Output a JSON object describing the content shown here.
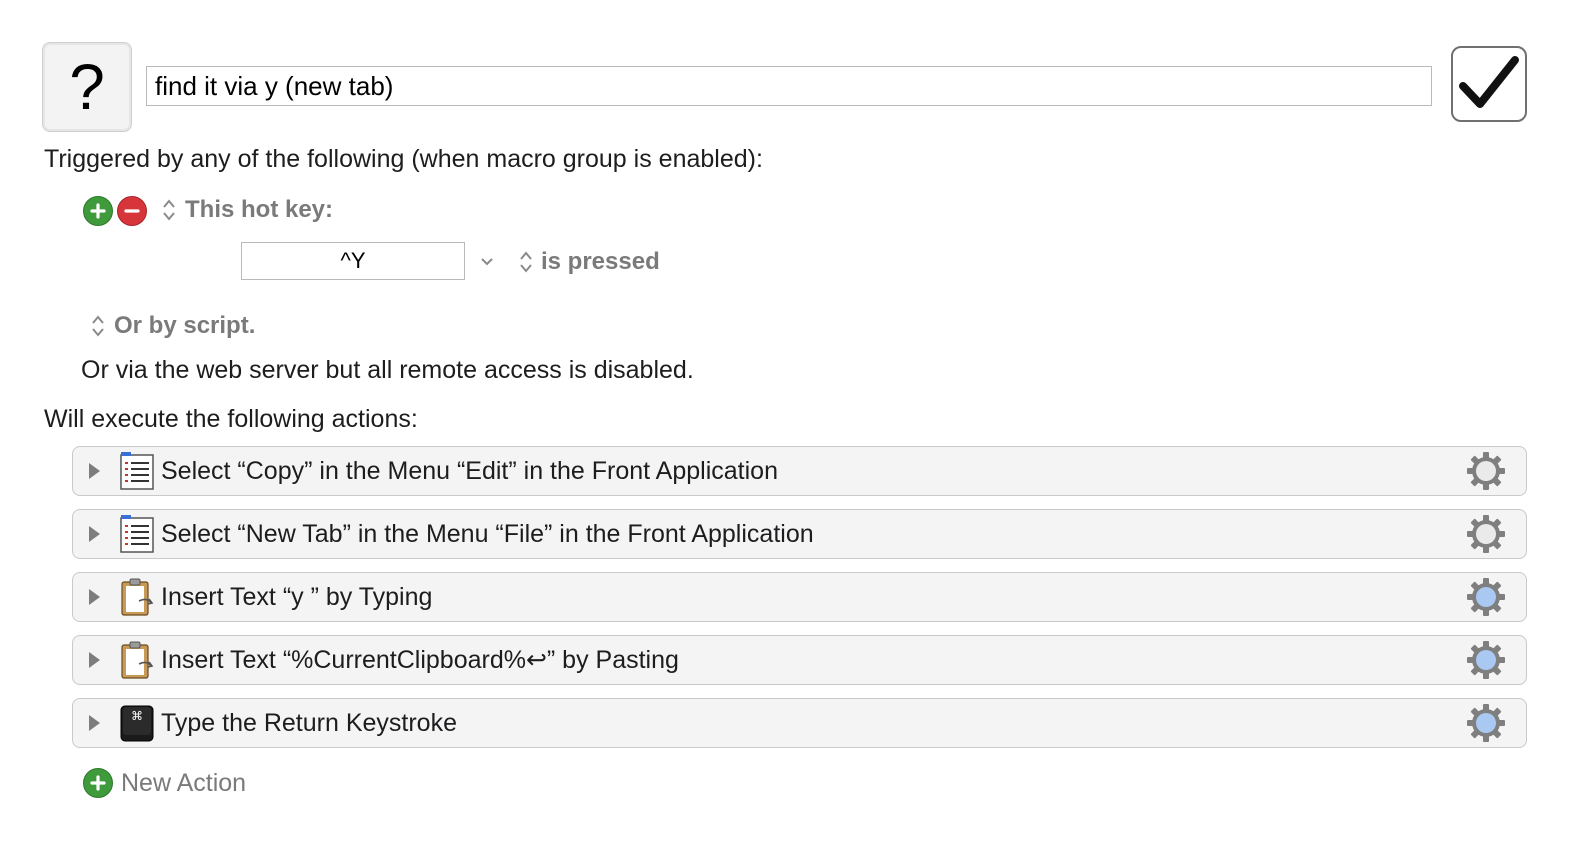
{
  "macro": {
    "icon_glyph": "?",
    "name": "find it via y (new tab)",
    "enabled": true
  },
  "triggers": {
    "heading": "Triggered by any of the following (when macro group is enabled):",
    "hotkey_label": "This hot key:",
    "hotkey_value": "^Y",
    "hotkey_condition": "is pressed",
    "script_label": "Or by script.",
    "web_server_note": "Or via the web server but all remote access is disabled."
  },
  "actions": {
    "heading": "Will execute the following actions:",
    "items": [
      {
        "label": "Select “Copy” in the Menu “Edit” in the Front Application",
        "icon": "menu-list-icon"
      },
      {
        "label": "Select “New Tab” in the Menu “File” in the Front Application",
        "icon": "menu-list-icon"
      },
      {
        "label": "Insert Text “y ” by Typing",
        "icon": "clipboard-icon"
      },
      {
        "label": "Insert Text “%CurrentClipboard%↩” by Pasting",
        "icon": "clipboard-icon"
      },
      {
        "label": "Type the Return Keystroke",
        "icon": "command-key-icon"
      }
    ],
    "new_action_label": "New Action"
  },
  "colors": {
    "add_green": "#3e9a3a",
    "remove_red": "#d6353a",
    "gear_blue": "#a9c8f2"
  }
}
